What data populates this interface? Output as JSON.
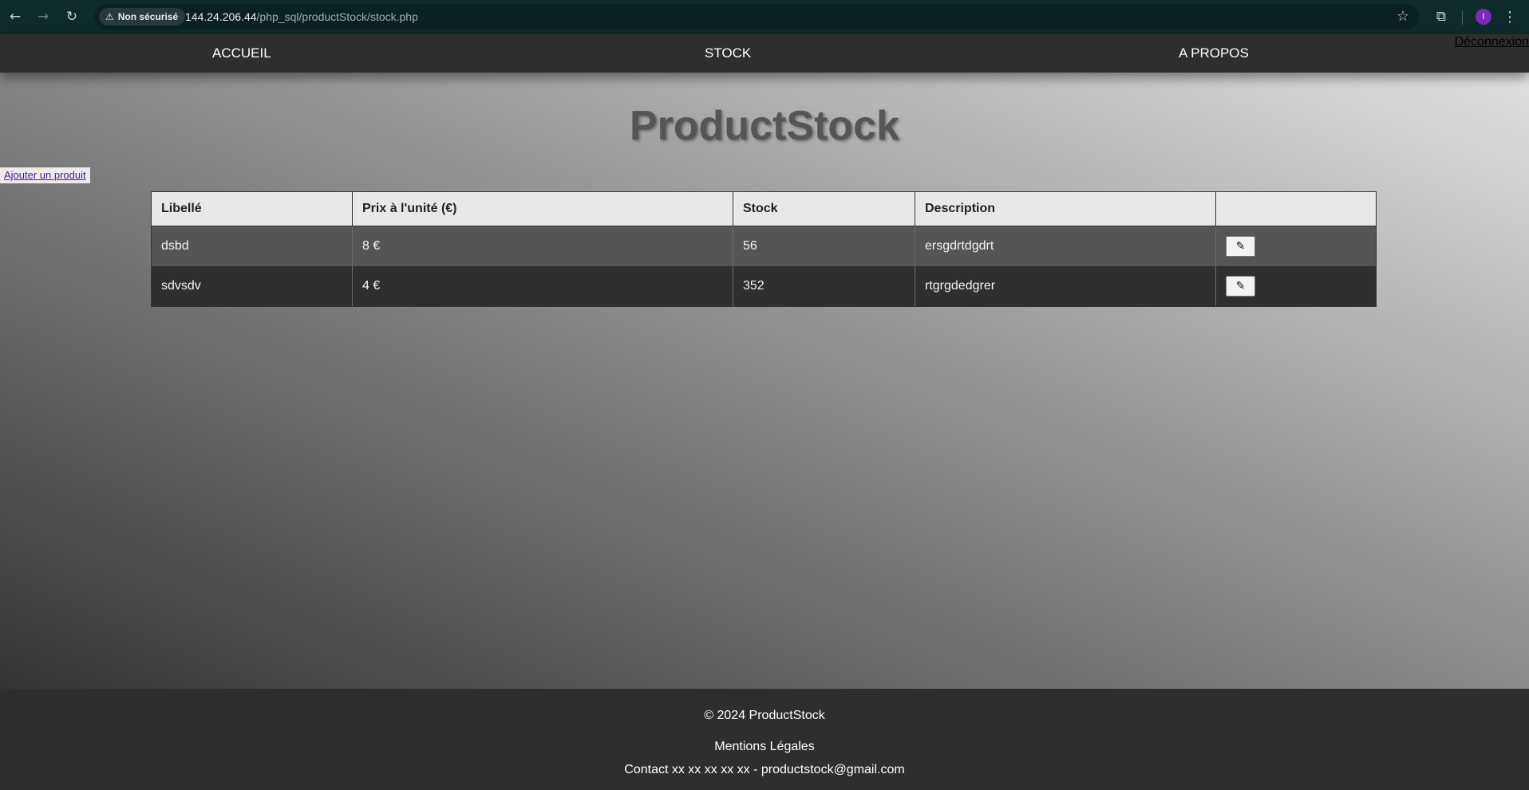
{
  "browser": {
    "security_label": "Non sécurisé",
    "url_host": "144.24.206.44",
    "url_path": "/php_sql/productStock/stock.php",
    "profile_initial": "I"
  },
  "nav": {
    "home": "ACCUEIL",
    "stock": "STOCK",
    "about": "A PROPOS",
    "logout": "Déconnexion"
  },
  "page": {
    "title": "ProductStock",
    "add_product": "Ajouter un produit"
  },
  "table": {
    "headers": [
      "Libellé",
      "Prix à l'unité (€)",
      "Stock",
      "Description",
      ""
    ],
    "rows": [
      {
        "label": "dsbd",
        "price": "8 €",
        "stock": "56",
        "description": "ersgdrtdgdrt"
      },
      {
        "label": "sdvsdv",
        "price": "4 €",
        "stock": "352",
        "description": "rtgrgdedgrer"
      }
    ]
  },
  "footer": {
    "copyright": "© 2024 ProductStock",
    "legal": "Mentions Légales",
    "contact": "Contact xx xx xx xx xx - productstock@gmail.com"
  },
  "icons": {
    "back": "arrow-left-icon",
    "forward": "arrow-right-icon",
    "reload": "reload-icon",
    "warning": "warning-icon",
    "star": "star-icon",
    "extensions": "puzzle-icon",
    "menu": "kebab-menu-icon",
    "edit": "pencil-icon"
  },
  "colors": {
    "nav_bg": "#2e2e2e",
    "title": "#555555",
    "row_odd": "#555555",
    "row_even": "#2f2f2f",
    "header_bg": "#e8e8e8",
    "profile": "#7b2bb5"
  }
}
